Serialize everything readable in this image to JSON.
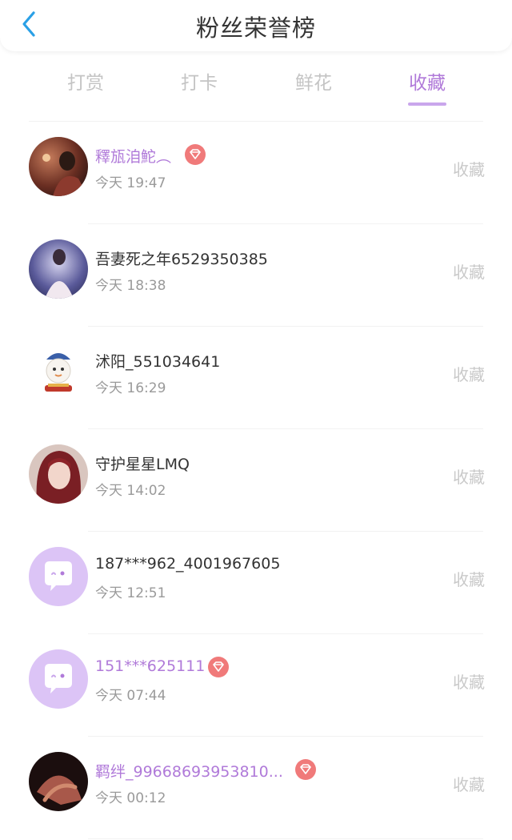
{
  "header": {
    "title": "粉丝荣誉榜",
    "back_icon": "chevron-left-icon"
  },
  "tabs": [
    {
      "label": "打赏",
      "active": false
    },
    {
      "label": "打卡",
      "active": false
    },
    {
      "label": "鲜花",
      "active": false
    },
    {
      "label": "收藏",
      "active": true
    }
  ],
  "colors": {
    "accent": "#b07ad9",
    "underline": "#c9a6ec",
    "gem": "#f07a7a",
    "default_avatar": "#dcc4f6"
  },
  "entries": [
    {
      "name": "釋瓬洎鮀︵",
      "time": "今天 19:47",
      "action": "收藏",
      "vip": true,
      "avatar": "photo-avatar"
    },
    {
      "name": "吾妻死之年6529350385",
      "time": "今天 18:38",
      "action": "收藏",
      "vip": false,
      "avatar": "photo-avatar"
    },
    {
      "name": "沭阳_551034641",
      "time": "今天 16:29",
      "action": "收藏",
      "vip": false,
      "avatar": "cartoon-avatar"
    },
    {
      "name": "守护星星LMQ",
      "time": "今天 14:02",
      "action": "收藏",
      "vip": false,
      "avatar": "photo-avatar"
    },
    {
      "name": "187***962_4001967605",
      "time": "今天 12:51",
      "action": "收藏",
      "vip": false,
      "avatar": "default-chat-avatar"
    },
    {
      "name": "151***625111",
      "time": "今天 07:44",
      "action": "收藏",
      "vip": true,
      "avatar": "default-chat-avatar"
    },
    {
      "name": "羁绊_99668693953810...",
      "time": "今天 00:12",
      "action": "收藏",
      "vip": true,
      "avatar": "photo-avatar"
    }
  ]
}
